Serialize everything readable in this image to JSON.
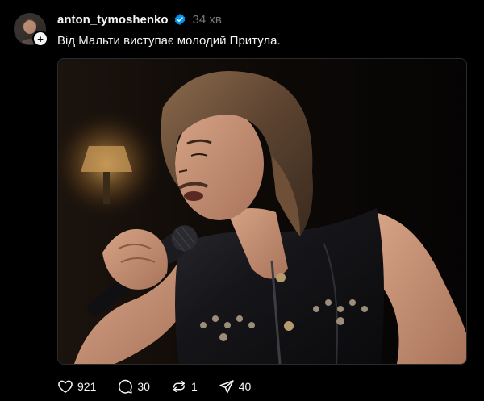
{
  "post": {
    "username": "anton_tymoshenko",
    "time": "34 хв",
    "caption": "Від Мальти виступає молодий Притула.",
    "image_alt": "Singer with long hair in a black leather vest singing into a microphone"
  },
  "actions": {
    "likes": "921",
    "replies": "30",
    "reposts": "1",
    "shares": "40"
  },
  "colors": {
    "background": "#000000",
    "text": "#f3f5f7",
    "secondary": "#777777",
    "verified": "#0095f6"
  },
  "icons": [
    "follow-plus-icon",
    "verified-badge-icon",
    "heart-icon",
    "comment-icon",
    "repost-icon",
    "share-icon"
  ]
}
